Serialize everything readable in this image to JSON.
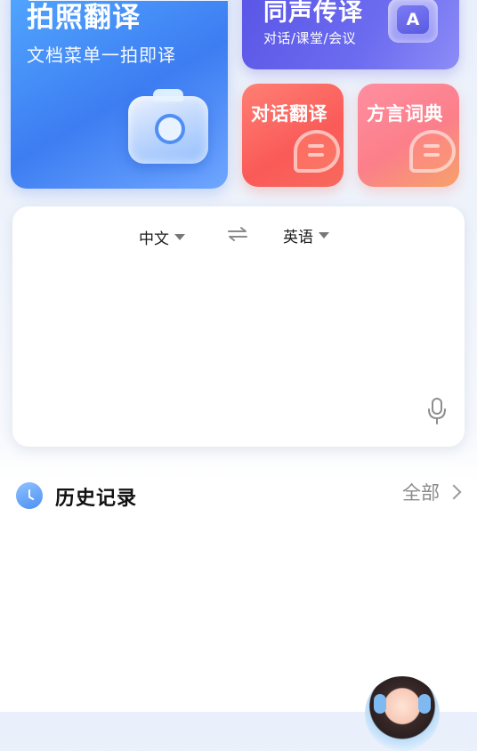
{
  "cards": {
    "photo": {
      "title": "拍照翻译",
      "subtitle": "文档菜单一拍即译",
      "icon": "camera-icon"
    },
    "simul": {
      "title": "同声传译",
      "subtitle": "对话/课堂/会议",
      "icon_letter": "A"
    },
    "dialog": {
      "title": "对话翻译",
      "icon": "chat-bubble-icon"
    },
    "dialect": {
      "title": "方言词典",
      "icon": "chat-bubble-icon"
    }
  },
  "translator": {
    "source_lang": "中文",
    "target_lang": "英语",
    "swap_icon": "swap-icon",
    "mic_icon": "microphone-icon"
  },
  "history": {
    "title": "历史记录",
    "all_label": "全部",
    "icon": "clock-icon"
  },
  "colors": {
    "photo_card": "#4a8ef8",
    "simul_card": "#5f5ce9",
    "dialog_card": "#fa5d58",
    "dialect_card": "#fb8a86"
  }
}
